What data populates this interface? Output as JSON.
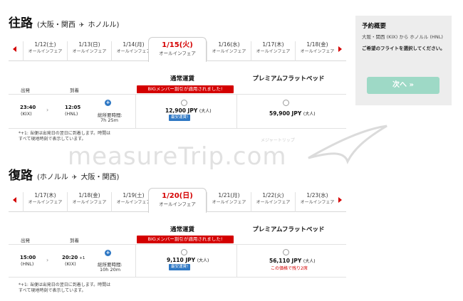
{
  "outbound": {
    "title": "往路",
    "from": "(大阪・関西",
    "to": "ホノルル)",
    "dates": [
      {
        "date": "1/12(土)",
        "fare": "オールインフェア"
      },
      {
        "date": "1/13(日)",
        "fare": "オールインフェア"
      },
      {
        "date": "1/14(月)",
        "fare": "オールインフェア"
      },
      {
        "date": "1/15(火)",
        "fare": "オールインフェア"
      },
      {
        "date": "1/16(水)",
        "fare": "オールインフェア"
      },
      {
        "date": "1/17(木)",
        "fare": "オールインフェア"
      },
      {
        "date": "1/18(金)",
        "fare": "オールインフェア"
      }
    ],
    "fare_header_normal": "通常運賃",
    "fare_header_premium": "プレミアムフラットベッド",
    "promo": "BIGメンバー割引が適用されました!",
    "col_depart": "出発",
    "col_arrive": "到着",
    "flight": {
      "dep_time": "23:40",
      "dep_code": "(KIX)",
      "arr_time": "12:05",
      "arr_code": "(HNL)",
      "duration_label": "総所要時間:",
      "duration": "7h 25m",
      "price_normal": "12,900 JPY",
      "price_premium": "59,900 JPY",
      "pax": "(大人)",
      "lowest": "最安運賃!"
    },
    "note1": "*+1: 当便は出発日の翌日に到着します。時間は",
    "note2": "すべて現地時刻で表示しています。"
  },
  "return": {
    "title": "復路",
    "from": "(ホノルル",
    "to": "大阪・関西)",
    "dates": [
      {
        "date": "1/17(木)",
        "fare": "オールインフェア"
      },
      {
        "date": "1/18(金)",
        "fare": "オールインフェア"
      },
      {
        "date": "1/19(土)",
        "fare": "オールインフェア"
      },
      {
        "date": "1/20(日)",
        "fare": "オールインフェア"
      },
      {
        "date": "1/21(月)",
        "fare": "オールインフェア"
      },
      {
        "date": "1/22(火)",
        "fare": "オールインフェア"
      },
      {
        "date": "1/23(水)",
        "fare": "オールインフェア"
      }
    ],
    "fare_header_normal": "通常運賃",
    "fare_header_premium": "プレミアムフラットベッド",
    "promo": "BIGメンバー割引が適用されました!",
    "col_depart": "出発",
    "col_arrive": "到着",
    "flight": {
      "dep_time": "15:00",
      "dep_code": "(HNL)",
      "arr_time": "20:20",
      "arr_plus": "+1",
      "arr_code": "(KIX)",
      "duration_label": "総所要時間:",
      "duration": "10h 20m",
      "price_normal": "9,110 JPY",
      "price_premium": "56,110 JPY",
      "pax": "(大人)",
      "lowest": "最安運賃!",
      "remaining": "この価格で残り2席"
    },
    "note1": "*+1: 当便は出発日の翌日に到着します。時間は",
    "note2": "すべて現地時刻で表示しています。"
  },
  "summary": {
    "title": "予約概要",
    "route": "大阪・関西 (KIX) から ホノルル (HNL)",
    "prompt": "ご希望のフライトを選択してください。",
    "next_label": "次へ »"
  },
  "watermark": {
    "main": "measureTrip.com",
    "sub": "メジャートリップ"
  },
  "colors": {
    "accent_red": "#d40000",
    "badge_blue": "#2f78c4",
    "next_button": "#9ed9c6"
  }
}
